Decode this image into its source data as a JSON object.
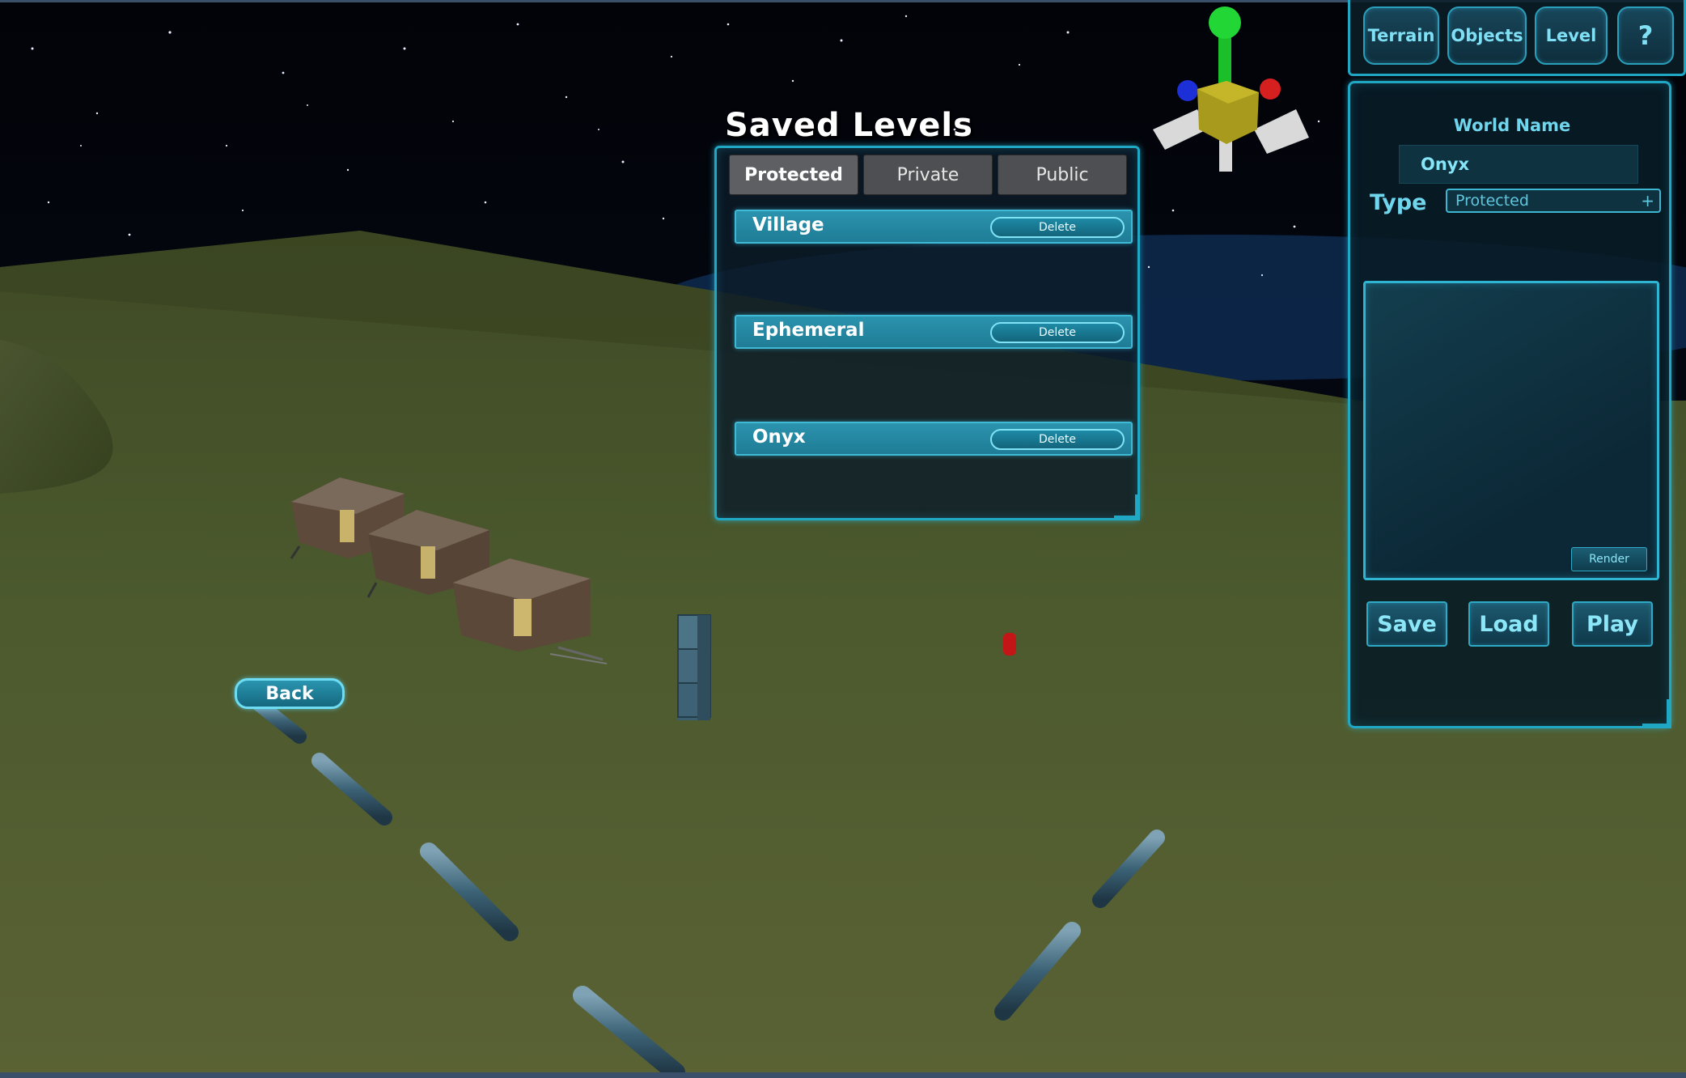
{
  "saved_levels": {
    "title": "Saved Levels",
    "tabs": [
      {
        "label": "Protected",
        "active": true
      },
      {
        "label": "Private",
        "active": false
      },
      {
        "label": "Public",
        "active": false
      }
    ],
    "levels": [
      {
        "name": "Village",
        "delete_label": "Delete"
      },
      {
        "name": "Ephemeral",
        "delete_label": "Delete"
      },
      {
        "name": "Onyx",
        "delete_label": "Delete"
      }
    ]
  },
  "back_button": {
    "label": "Back"
  },
  "toolbar": {
    "buttons": [
      {
        "label": "Terrain"
      },
      {
        "label": "Objects"
      },
      {
        "label": "Level"
      },
      {
        "label": "?"
      }
    ]
  },
  "world_panel": {
    "world_name_label": "World Name",
    "world_name_value": "Onyx",
    "type_label": "Type",
    "type_value": "Protected",
    "render_label": "Render",
    "save_label": "Save",
    "load_label": "Load",
    "play_label": "Play"
  },
  "colors": {
    "accent": "#1fa7c4",
    "row": "#2b93ae",
    "text_cyan": "#6fd6ee",
    "ground": "#4c5a2e",
    "sky": "#05070c"
  },
  "icons": {
    "gizmo": "transform-gizmo-icon",
    "dropdown": "dropdown-arrow-icon"
  }
}
